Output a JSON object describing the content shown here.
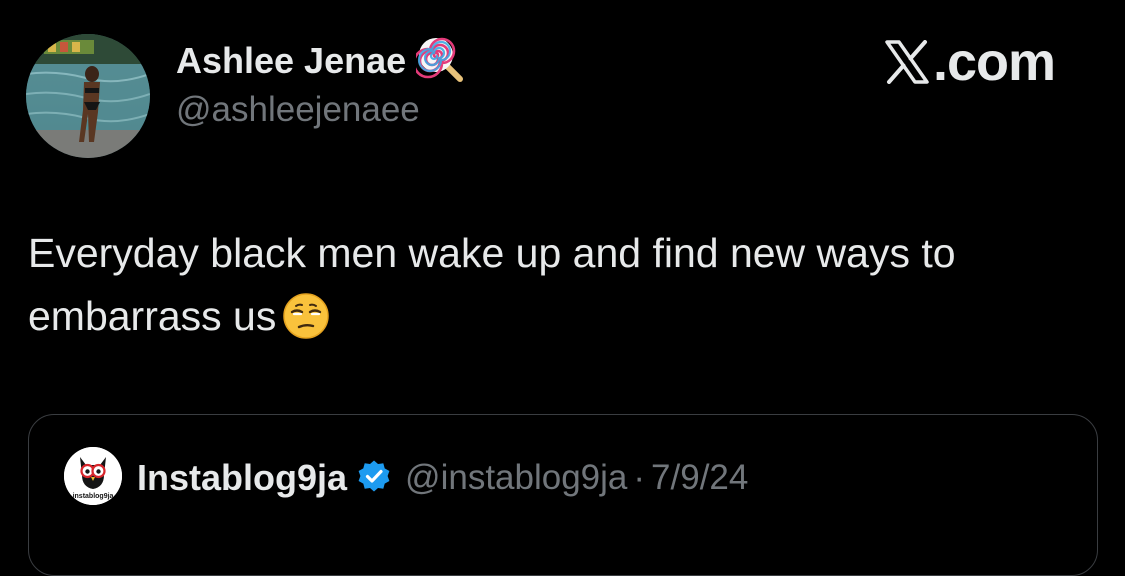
{
  "author": {
    "display_name": "Ashlee Jenae",
    "name_emoji": "lollipop-icon",
    "handle": "@ashleejenaee",
    "avatar": "profile-photo"
  },
  "branding": {
    "logo": "x-logo-icon",
    "text": ".com"
  },
  "tweet": {
    "text": "Everyday black men wake up and find new ways to embarrass us",
    "emoji": "unamused-face-emoji"
  },
  "quoted": {
    "display_name": "Instablog9ja",
    "verified": "verified-badge-icon",
    "handle": "@instablog9ja",
    "separator": "·",
    "date": "7/9/24",
    "avatar_text": "instablog9ja"
  },
  "colors": {
    "background": "#000000",
    "primary_text": "#e7e9ea",
    "secondary_text": "#71767b",
    "border": "#3a3d41",
    "verified_blue": "#1d9bf0"
  }
}
